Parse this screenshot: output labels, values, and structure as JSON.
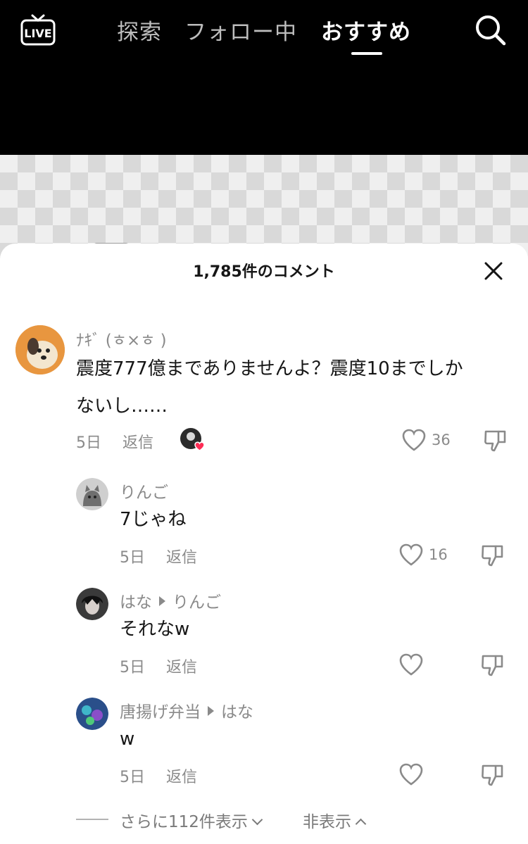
{
  "topbar": {
    "live_label": "LIVE",
    "tabs": [
      "探索",
      "フォロー中",
      "おすすめ"
    ],
    "active_tab": "おすすめ"
  },
  "sheet": {
    "title": "1,785件のコメント"
  },
  "comments": [
    {
      "username": "ﾅｷﾞ (ㅎ×ㅎ )",
      "text_lines": [
        "震度777億までありませんよ？震度10までしか",
        "ないし……"
      ],
      "age": "5日",
      "reply_label": "返信",
      "likes": "36",
      "liked_by_creator": true
    },
    {
      "username": "りんご",
      "text_lines": [
        "7じゃね"
      ],
      "age": "5日",
      "reply_label": "返信",
      "likes": "16"
    },
    {
      "username": "はな",
      "reply_to": "りんご",
      "text_lines": [
        "それなw"
      ],
      "age": "5日",
      "reply_label": "返信",
      "likes": ""
    },
    {
      "username": "唐揚げ弁当",
      "reply_to": "はな",
      "text_lines": [
        "w"
      ],
      "age": "5日",
      "reply_label": "返信",
      "likes": ""
    }
  ],
  "footer": {
    "more_label": "さらに112件表示",
    "hide_label": "非表示"
  },
  "colors": {
    "like_heart": "#fe2c55",
    "muted_text": "#8a8a8a"
  }
}
